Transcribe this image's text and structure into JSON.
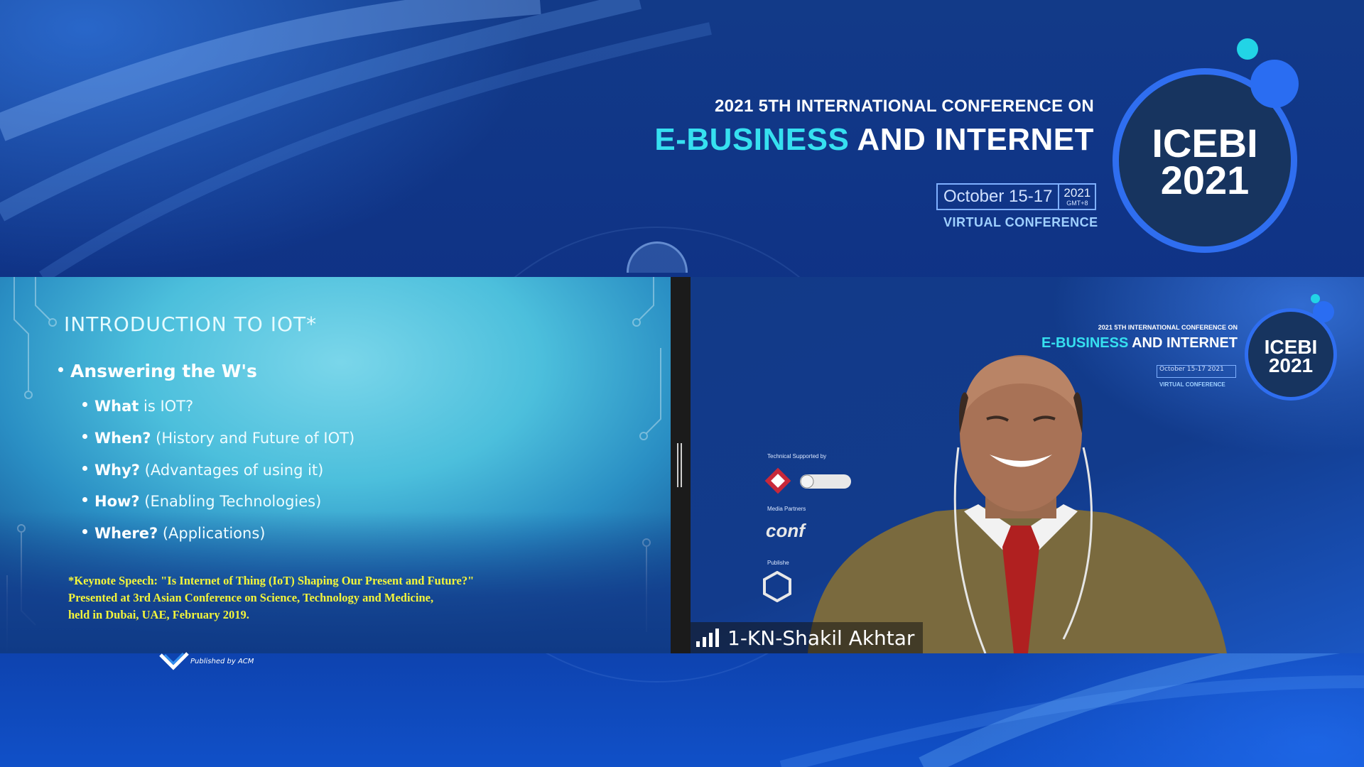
{
  "header": {
    "line1": "2021 5TH INTERNATIONAL CONFERENCE ON",
    "line2_accent": "E-BUSINESS",
    "line2_rest": " AND INTERNET",
    "dates": "October 15-17",
    "year": "2021",
    "timezone": "GMT+8",
    "virtual": "VIRTUAL CONFERENCE"
  },
  "logo": {
    "line1": "ICEBI",
    "line2": "2021"
  },
  "slide": {
    "title": "INTRODUCTION TO IOT*",
    "main_bullet": "Answering the W's",
    "sub_bullets": [
      {
        "key": "What",
        "rest": " is IOT?"
      },
      {
        "key": "When?",
        "rest": " (History and Future of IOT)"
      },
      {
        "key": "Why?",
        "rest": " (Advantages of using it)"
      },
      {
        "key": "How?",
        "rest": " (Enabling Technologies)"
      },
      {
        "key": "Where?",
        "rest": " (Applications)"
      }
    ],
    "keynote_lines": [
      "*Keynote Speech: \"Is Internet of Thing (IoT) Shaping Our Present and Future?\"",
      "Presented at 3rd Asian Conference on Science, Technology and Medicine,",
      "held in Dubai, UAE, February 2019."
    ]
  },
  "video": {
    "line1": "2021 5TH INTERNATIONAL CONFERENCE ON",
    "line2_accent": "E-BUSINESS",
    "line2_rest": " AND INTERNET",
    "dates": "October 15-17",
    "year": "2021",
    "virtual": "VIRTUAL CONFERENCE",
    "logo_line1": "ICEBI",
    "logo_line2": "2021",
    "technical_supported": "Technical Supported by",
    "media_partners": "Media Partners",
    "published": "Publishe",
    "participant_name": "1-KN-Shakil Akhtar"
  },
  "footer": {
    "acm_text": "Published by ACM"
  },
  "colors": {
    "accent": "#36e0f0",
    "brand_blue": "#2f6ef0",
    "keynote_yellow": "#f3f53a"
  }
}
